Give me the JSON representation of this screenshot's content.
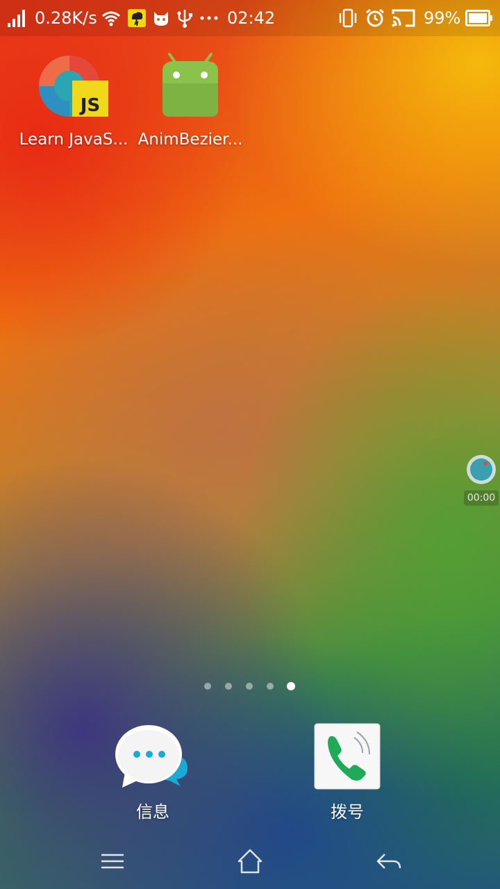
{
  "status_bar": {
    "network_speed": "0.28K/s",
    "time": "02:42",
    "battery": "99%",
    "more_icon": "more-dots-icon",
    "icons": [
      "signal-icon",
      "wifi-icon",
      "weather-notification-icon",
      "cat-notification-icon",
      "usb-icon",
      "more-dots-icon",
      "vibrate-icon",
      "alarm-icon",
      "cast-icon",
      "battery-icon"
    ]
  },
  "home": {
    "apps": [
      {
        "label": "Learn JavaS...",
        "icon": "learn-javascript-icon"
      },
      {
        "label": "AnimBezier...",
        "icon": "android-icon"
      }
    ]
  },
  "floating_recorder": {
    "time": "00:00"
  },
  "page_indicator": {
    "count": 5,
    "active_index": 4
  },
  "dock": {
    "apps": [
      {
        "label": "信息",
        "icon": "messages-icon"
      },
      {
        "label": "拨号",
        "icon": "phone-icon"
      }
    ]
  },
  "nav_bar": {
    "buttons": [
      "menu-icon",
      "home-icon",
      "back-icon"
    ]
  },
  "colors": {
    "js_yellow": "#f0d91a",
    "android_green": "#8bc34a",
    "message_blue": "#1ba9d6",
    "phone_green": "#1faa58"
  }
}
